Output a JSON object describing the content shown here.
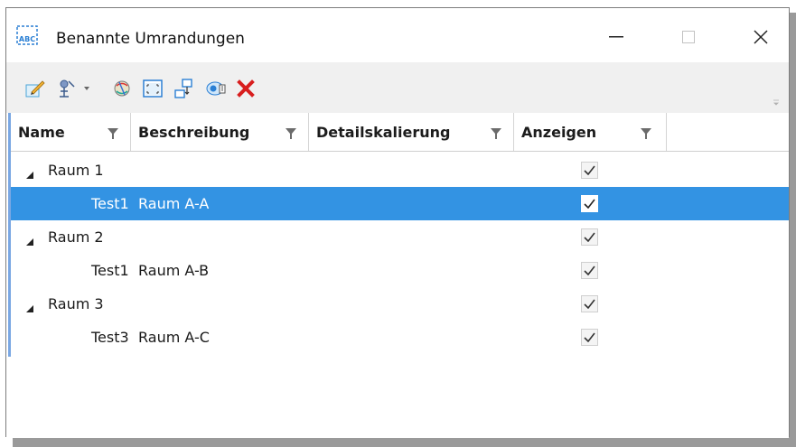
{
  "window": {
    "title": "Benannte Umrandungen",
    "app_icon_text": "ABC"
  },
  "toolbar": {
    "buttons": [
      {
        "icon": "edit-pencil-icon"
      },
      {
        "icon": "clip-tool-icon",
        "has_dropdown": true
      },
      {
        "icon": "render-sphere-icon"
      },
      {
        "icon": "fit-view-icon"
      },
      {
        "icon": "group-arrange-icon"
      },
      {
        "icon": "info-eye-icon"
      },
      {
        "icon": "delete-icon",
        "color": "#d81e1e"
      }
    ]
  },
  "grid": {
    "columns": [
      {
        "label": "Name",
        "filter": true
      },
      {
        "label": "Beschreibung",
        "filter": true
      },
      {
        "label": "Detailskalierung",
        "filter": true
      },
      {
        "label": "Anzeigen",
        "filter": true
      }
    ],
    "rows": [
      {
        "type": "group",
        "name": "Raum 1",
        "description": "",
        "show": true,
        "selected": false
      },
      {
        "type": "child",
        "name": "Test1",
        "description": "Raum A-A",
        "show": true,
        "selected": true
      },
      {
        "type": "group",
        "name": "Raum 2",
        "description": "",
        "show": true,
        "selected": false
      },
      {
        "type": "child",
        "name": "Test1",
        "description": "Raum A-B",
        "show": true,
        "selected": false
      },
      {
        "type": "group",
        "name": "Raum 3",
        "description": "",
        "show": true,
        "selected": false
      },
      {
        "type": "child",
        "name": "Test3",
        "description": "Raum A-C",
        "show": true,
        "selected": false
      }
    ]
  },
  "colors": {
    "selection": "#3393e3",
    "accent_bar": "#7aa7e3",
    "delete": "#d81e1e"
  }
}
